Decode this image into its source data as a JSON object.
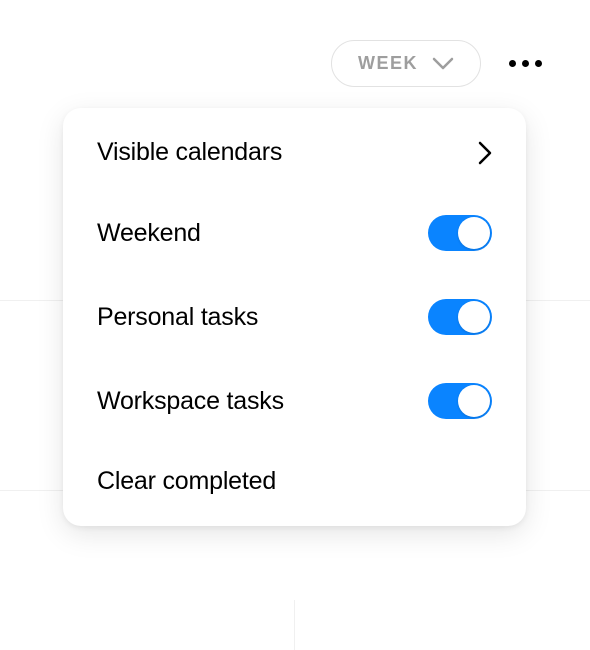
{
  "toolbar": {
    "view_selector": {
      "label": "WEEK"
    }
  },
  "menu": {
    "items": [
      {
        "label": "Visible calendars",
        "type": "submenu"
      },
      {
        "label": "Weekend",
        "type": "toggle",
        "on": true
      },
      {
        "label": "Personal tasks",
        "type": "toggle",
        "on": true
      },
      {
        "label": "Workspace tasks",
        "type": "toggle",
        "on": true
      },
      {
        "label": "Clear completed",
        "type": "action"
      }
    ]
  },
  "colors": {
    "toggle_on": "#0a84ff"
  }
}
